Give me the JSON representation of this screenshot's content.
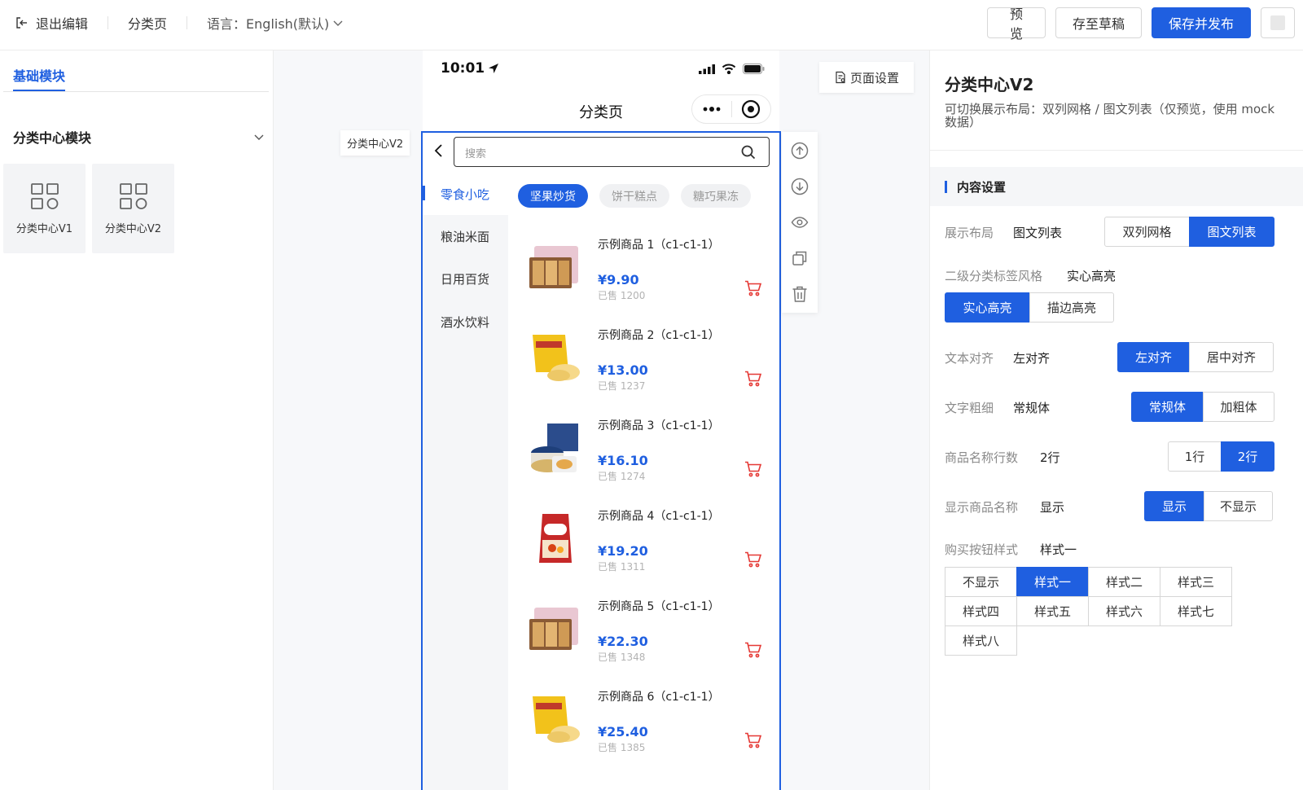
{
  "topbar": {
    "exit_label": "退出编辑",
    "page_name": "分类页",
    "language_label": "语言：English(默认)",
    "buttons": {
      "preview": "预览",
      "save_draft": "存至草稿",
      "save_publish": "保存并发布"
    }
  },
  "left_panel": {
    "tab": "基础模块",
    "group_title": "分类中心模块",
    "modules": [
      {
        "label": "分类中心V1"
      },
      {
        "label": "分类中心V2"
      }
    ]
  },
  "canvas": {
    "component_tag": "分类中心V2",
    "page_settings": "页面设置"
  },
  "phone": {
    "time": "10:01",
    "nav_title": "分类页",
    "search_placeholder": "搜索",
    "categories": [
      "零食小吃",
      "粮油米面",
      "日用百货",
      "酒水饮料"
    ],
    "sub_tabs": [
      "坚果炒货",
      "饼干糕点",
      "糖巧果冻"
    ],
    "goods": [
      {
        "name": "示例商品 1（c1-c1-1）",
        "price": "¥9.90",
        "sold": "已售 1200",
        "thumb": "biscuit-box"
      },
      {
        "name": "示例商品 2（c1-c1-1）",
        "price": "¥13.00",
        "sold": "已售 1237",
        "thumb": "chips-bag"
      },
      {
        "name": "示例商品 3（c1-c1-1）",
        "price": "¥16.10",
        "sold": "已售 1274",
        "thumb": "cookie-tin"
      },
      {
        "name": "示例商品 4（c1-c1-1）",
        "price": "¥19.20",
        "sold": "已售 1311",
        "thumb": "cereal-bag"
      },
      {
        "name": "示例商品 5（c1-c1-1）",
        "price": "¥22.30",
        "sold": "已售 1348",
        "thumb": "biscuit-box"
      },
      {
        "name": "示例商品 6（c1-c1-1）",
        "price": "¥25.40",
        "sold": "已售 1385",
        "thumb": "chips-bag"
      }
    ]
  },
  "toolbar_icons": [
    "move-up-icon",
    "move-down-icon",
    "eye-icon",
    "copy-icon",
    "trash-icon"
  ],
  "right_panel": {
    "title": "分类中心V2",
    "desc": "可切换展示布局：双列网格 / 图文列表（仅预览，使用 mock 数据）",
    "section": "内容设置",
    "settings": {
      "layout": {
        "label": "展示布局",
        "value": "图文列表",
        "options": [
          "双列网格",
          "图文列表"
        ]
      },
      "tag_style": {
        "label": "二级分类标签风格",
        "value": "实心高亮",
        "options": [
          "实心高亮",
          "描边高亮"
        ]
      },
      "align": {
        "label": "文本对齐",
        "value": "左对齐",
        "options": [
          "左对齐",
          "居中对齐"
        ]
      },
      "weight": {
        "label": "文字粗细",
        "value": "常规体",
        "options": [
          "常规体",
          "加粗体"
        ]
      },
      "lines": {
        "label": "商品名称行数",
        "value": "2行",
        "options": [
          "1行",
          "2行"
        ]
      },
      "show_name": {
        "label": "显示商品名称",
        "value": "显示",
        "options": [
          "显示",
          "不显示"
        ]
      },
      "buy_btn": {
        "label": "购买按钮样式",
        "value": "样式一",
        "options": [
          "不显示",
          "样式一",
          "样式二",
          "样式三",
          "样式四",
          "样式五",
          "样式六",
          "样式七",
          "样式八"
        ]
      }
    }
  },
  "colors": {
    "primary": "#1f5fe0",
    "cart": "#e53935",
    "side_bg": "#f5f6f8"
  }
}
